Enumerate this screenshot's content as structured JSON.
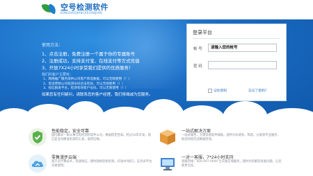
{
  "header": {
    "logo_cn": "空号检测软件",
    "logo_en": "KONGHAOJIANCERUANJIAN"
  },
  "howto": {
    "title": "使用方法：",
    "steps": [
      "1、点击注册，免费注册一个属于你的专属账号",
      "2、注册成功，支持支付宝、在线支付等方式充值",
      "3、开放7X24小时享受我们提供的优质服务！"
    ],
    "sub_title": "我们的客户主要有：",
    "sub_items": [
      "1、网络推广服务提供公司客户筛选数据，可以无限使用（！）",
      "2、电话营销公司检测号码合法有效，可以无限使用（！）",
      "3、短信群发平台，检测有效客户号码，可以无限使用（！）"
    ],
    "footnote": "如果您有任何疑问，请联系您的客户经理，我们将竭诚为您服务。"
  },
  "login": {
    "title": "登录平台",
    "username_label": "帐  号",
    "username_placeholder": "请输入您的帐号",
    "password_label": "密  码",
    "password_value": "",
    "remember_label": "记住密码",
    "forgot_label": "忘记了密码？"
  },
  "features": [
    {
      "icon": "shield-check-icon",
      "title": "性能稳定，安全可靠",
      "desc": "国内最早一家从事号码检测的软件公司，数据稳定性高。经过10年开发，现已是业内精准检测的工具，值得信赖。"
    },
    {
      "icon": "package-box-icon",
      "title": "一站式解决方案",
      "desc": "一站式服务，无需其他软件辅助。提供号码清洗、筛选、分类等专业服务，助您轻松完成数据检测。"
    },
    {
      "icon": "cloud-sync-icon",
      "title": "零售漫步云端",
      "desc": "基于云计算技术，快速响应，随时随地轻松检测。开放API接口，支持多平台对接使用。"
    },
    {
      "icon": "computer-support-icon",
      "title": "一对一客服，7*24小时支持",
      "desc": "客服热线：400-097-0094 全天候在线服务，随时为您解答各类问题，让您使用无忧。"
    }
  ],
  "colors": {
    "banner_dark": "#0f57a8",
    "banner_light": "#2f8fe0",
    "link": "#2a6fc2",
    "logo": "#1f6fc2"
  }
}
